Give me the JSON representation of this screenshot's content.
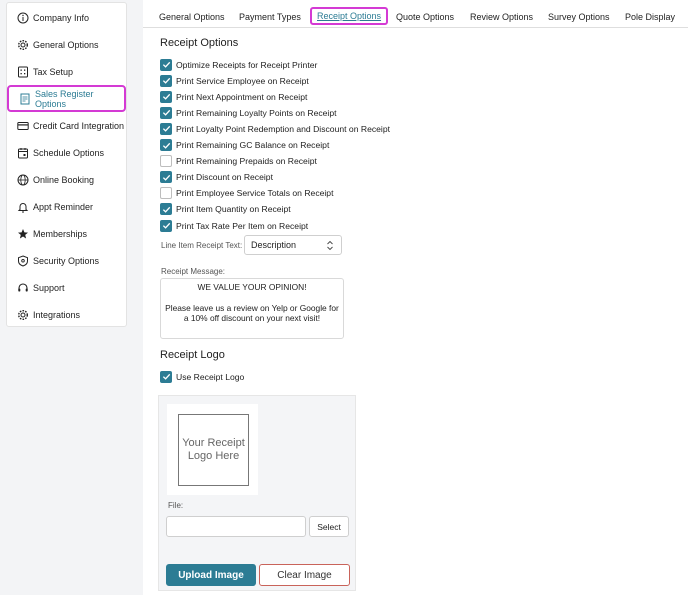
{
  "sidebar": {
    "items": [
      {
        "label": "Company Info",
        "icon": "info-icon"
      },
      {
        "label": "General Options",
        "icon": "gear-icon"
      },
      {
        "label": "Tax Setup",
        "icon": "calculator-icon"
      },
      {
        "label": "Sales Register Options",
        "icon": "receipt-icon",
        "active": true
      },
      {
        "label": "Credit Card Integration",
        "icon": "credit-card-icon"
      },
      {
        "label": "Schedule Options",
        "icon": "calendar-icon"
      },
      {
        "label": "Online Booking",
        "icon": "globe-icon"
      },
      {
        "label": "Appt Reminder",
        "icon": "bell-icon"
      },
      {
        "label": "Memberships",
        "icon": "star-icon"
      },
      {
        "label": "Security Options",
        "icon": "shield-icon"
      },
      {
        "label": "Support",
        "icon": "headset-icon"
      },
      {
        "label": "Integrations",
        "icon": "gear-icon"
      }
    ]
  },
  "tabs": [
    {
      "label": "General Options"
    },
    {
      "label": "Payment Types"
    },
    {
      "label": "Receipt Options",
      "active": true
    },
    {
      "label": "Quote Options"
    },
    {
      "label": "Review Options"
    },
    {
      "label": "Survey Options"
    },
    {
      "label": "Pole Display"
    }
  ],
  "receipt_options": {
    "title": "Receipt Options",
    "checkboxes": [
      {
        "label": "Optimize Receipts for Receipt Printer",
        "checked": true
      },
      {
        "label": "Print Service Employee on Receipt",
        "checked": true
      },
      {
        "label": "Print Next Appointment on Receipt",
        "checked": true
      },
      {
        "label": "Print Remaining Loyalty Points on Receipt",
        "checked": true
      },
      {
        "label": "Print Loyalty Point Redemption and Discount on Receipt",
        "checked": true
      },
      {
        "label": "Print Remaining GC Balance on Receipt",
        "checked": true
      },
      {
        "label": "Print Remaining Prepaids on Receipt",
        "checked": false
      },
      {
        "label": "Print Discount on Receipt",
        "checked": true
      },
      {
        "label": "Print Employee Service Totals on Receipt",
        "checked": false
      },
      {
        "label": "Print Item Quantity on Receipt",
        "checked": true
      },
      {
        "label": "Print Tax Rate Per Item on Receipt",
        "checked": true
      }
    ],
    "line_item_label": "Line Item Receipt Text:",
    "line_item_value": "Description",
    "message_label": "Receipt Message:",
    "message_line1": "WE VALUE YOUR OPINION!",
    "message_line2": "Please leave us a review on Yelp or Google for a 10% off discount on your next visit!"
  },
  "receipt_logo": {
    "title": "Receipt Logo",
    "use_logo_label": "Use Receipt Logo",
    "use_logo_checked": true,
    "placeholder_line1": "Your Receipt",
    "placeholder_line2": "Logo Here",
    "file_label": "File:",
    "file_value": "",
    "select_label": "Select",
    "upload_label": "Upload Image",
    "clear_label": "Clear Image"
  },
  "colors": {
    "accent": "#2c7c94",
    "highlight": "#d43ad4",
    "danger_border": "#c9635a"
  }
}
